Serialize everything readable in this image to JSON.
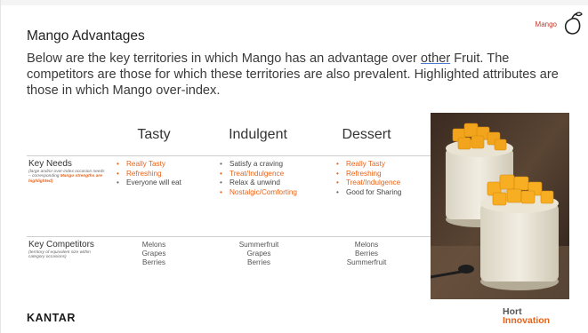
{
  "header": {
    "brand_tag": "Mango",
    "title": "Mango Advantages",
    "intro_part1": "Below are the key territories in which Mango has an advantage over ",
    "intro_underlined": "other",
    "intro_part2": " Fruit.  The competitors are those for which these territories are also prevalent.  Highlighted attributes are those in which Mango over-index."
  },
  "columns": [
    "Tasty",
    "Indulgent",
    "Dessert"
  ],
  "key_needs": {
    "label": "Key Needs",
    "sublabel_part1": "(large and/or over-index occasion needs – corresponding ",
    "sublabel_highlight": "Mango strengths are highlighted)",
    "tasty": [
      {
        "text": "Really Tasty",
        "highlight": true
      },
      {
        "text": "Refreshing",
        "highlight": true
      },
      {
        "text": "Everyone will eat",
        "highlight": false
      }
    ],
    "indulgent": [
      {
        "text": "Satisfy a craving",
        "highlight": false
      },
      {
        "text": "Treat/Indulgence",
        "highlight": true
      },
      {
        "text": "Relax & unwind",
        "highlight": false
      },
      {
        "text": "Nostalgic/Comforting",
        "highlight": true
      }
    ],
    "dessert": [
      {
        "text": "Really Tasty",
        "highlight": true
      },
      {
        "text": "Refreshing",
        "highlight": true
      },
      {
        "text": "Treat/Indulgence",
        "highlight": true
      },
      {
        "text": "Good for Sharing",
        "highlight": false
      }
    ]
  },
  "key_competitors": {
    "label": "Key Competitors",
    "sublabel": "(territory of equivalent size within category occasions)",
    "tasty": [
      "Melons",
      "Grapes",
      "Berries"
    ],
    "indulgent": [
      "Summerfruit",
      "Grapes",
      "Berries"
    ],
    "dessert": [
      "Melons",
      "Berries",
      "Summerfruit"
    ]
  },
  "footer": {
    "kantar": "KANTAR",
    "hort_line1": "Hort",
    "hort_line2": "Innovation"
  },
  "colors": {
    "highlight": "#e8631a",
    "text": "#333333"
  },
  "icons": {
    "brand": "mango-outline-icon",
    "photo": "mango-chia-pudding-photo"
  }
}
